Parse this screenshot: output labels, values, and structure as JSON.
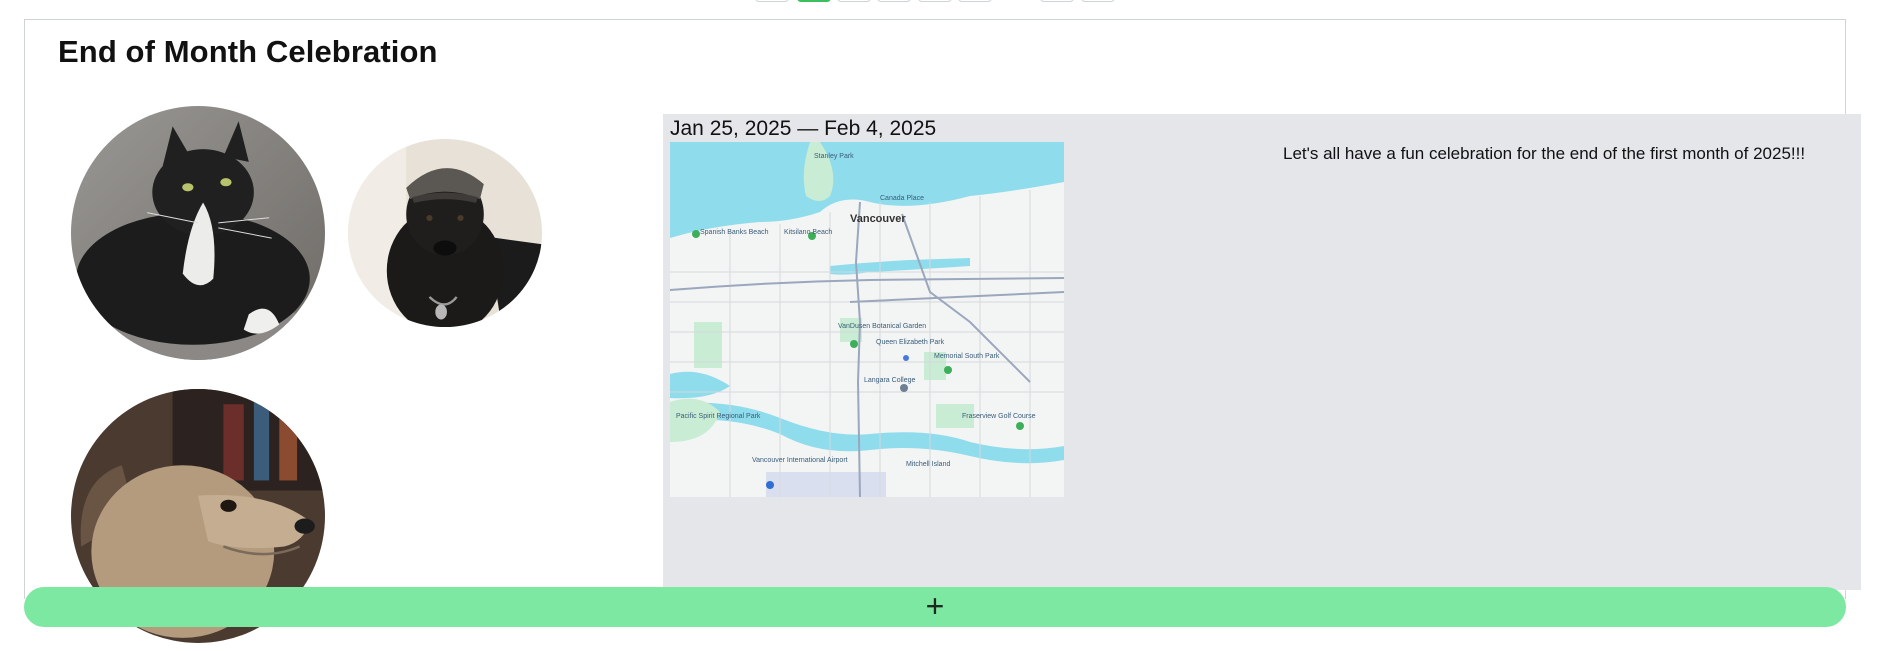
{
  "event": {
    "title": "End of Month Celebration",
    "dates": "Jan 25, 2025 — Feb 4, 2025",
    "description": "Let's all have a fun celebration for the end of the first month of 2025!!!"
  },
  "map": {
    "city_label": "Vancouver",
    "labels": [
      "Stanley Park",
      "Canada Place",
      "Spanish Banks Beach",
      "Kitsilano Beach",
      "VanDusen Botanical Garden",
      "Queen Elizabeth Park",
      "Memorial South Park",
      "Langara College",
      "Pacific Spirit Regional Park",
      "Fraserview Golf Course",
      "Vancouver International Airport",
      "Mitchell Island"
    ]
  },
  "add_button": {
    "label": "+"
  },
  "colors": {
    "accent": "#7de8a1",
    "pager_active": "#3cc05f",
    "panel": "#e4e6ea",
    "water": "#8fdcec",
    "park": "#c9ecd4"
  }
}
